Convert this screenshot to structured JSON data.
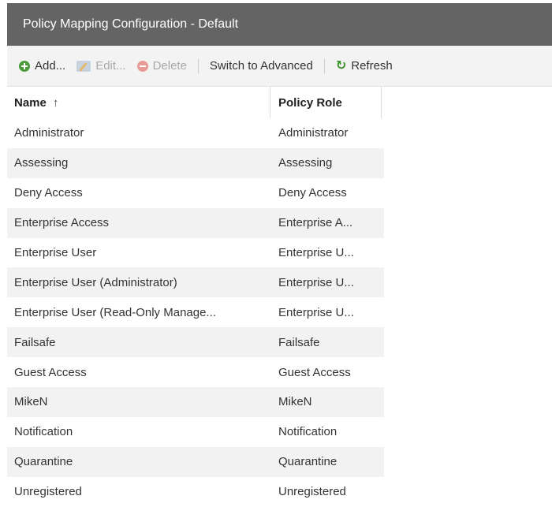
{
  "window": {
    "title": "Policy Mapping Configuration - Default"
  },
  "toolbar": {
    "add_label": "Add...",
    "edit_label": "Edit...",
    "delete_label": "Delete",
    "switch_label": "Switch to Advanced",
    "refresh_label": "Refresh"
  },
  "table": {
    "columns": {
      "name": "Name",
      "role": "Policy Role"
    },
    "sort_indicator": "↑",
    "rows": [
      {
        "name": "Administrator",
        "role": "Administrator"
      },
      {
        "name": "Assessing",
        "role": "Assessing"
      },
      {
        "name": "Deny Access",
        "role": "Deny Access"
      },
      {
        "name": "Enterprise Access",
        "role": "Enterprise A..."
      },
      {
        "name": "Enterprise User",
        "role": "Enterprise U..."
      },
      {
        "name": "Enterprise User (Administrator)",
        "role": "Enterprise U..."
      },
      {
        "name": "Enterprise User (Read-Only Manage...",
        "role": "Enterprise U..."
      },
      {
        "name": "Failsafe",
        "role": "Failsafe"
      },
      {
        "name": "Guest Access",
        "role": "Guest Access"
      },
      {
        "name": "MikeN",
        "role": "MikeN"
      },
      {
        "name": "Notification",
        "role": "Notification"
      },
      {
        "name": "Quarantine",
        "role": "Quarantine"
      },
      {
        "name": "Unregistered",
        "role": "Unregistered"
      }
    ]
  },
  "icons": {
    "add": "add-icon",
    "edit": "edit-icon",
    "delete": "delete-icon",
    "refresh": "refresh-icon"
  },
  "colors": {
    "titlebar": "#646464",
    "toolbar": "#f3f3f3",
    "add_green": "#4c9a3a",
    "refresh_green": "#3d8f2b",
    "row_alt": "#f2f2f2"
  }
}
